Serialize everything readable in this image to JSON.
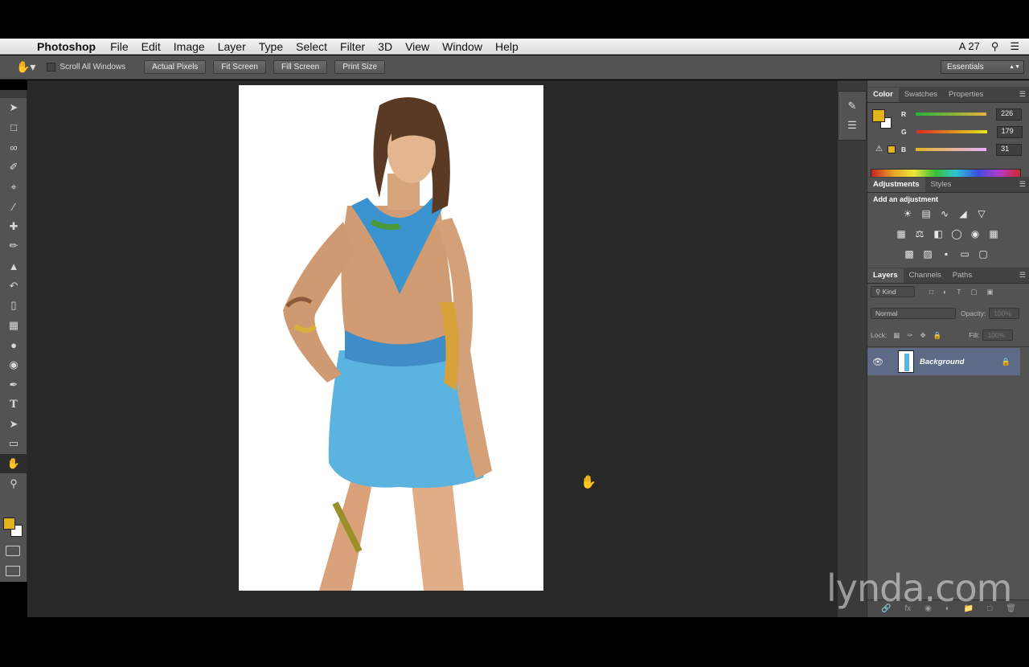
{
  "menubar": {
    "app_name": "Photoshop",
    "items": [
      "File",
      "Edit",
      "Image",
      "Layer",
      "Type",
      "Select",
      "Filter",
      "3D",
      "View",
      "Window",
      "Help"
    ],
    "status_number": "27"
  },
  "options_bar": {
    "scroll_all_windows": "Scroll All Windows",
    "actual_pixels": "Actual Pixels",
    "fit_screen": "Fit Screen",
    "fill_screen": "Fill Screen",
    "print_size": "Print Size",
    "workspace": "Essentials"
  },
  "tools": [
    "move",
    "marquee",
    "lasso",
    "quick-select",
    "crop",
    "eyedropper",
    "healing",
    "brush",
    "clone-stamp",
    "history-brush",
    "eraser",
    "gradient",
    "blur",
    "dodge",
    "pen",
    "type",
    "path-select",
    "rectangle",
    "hand",
    "zoom"
  ],
  "colors": {
    "foreground": "#e2b31f",
    "background": "#ffffff",
    "accent": "#5d6b86"
  },
  "color_panel": {
    "tabs": [
      "Color",
      "Swatches",
      "Properties"
    ],
    "r_label": "R",
    "g_label": "G",
    "b_label": "B",
    "r": "226",
    "g": "179",
    "b": "31"
  },
  "adjustments_panel": {
    "tabs": [
      "Adjustments",
      "Styles"
    ],
    "heading": "Add an adjustment"
  },
  "layers_panel": {
    "tabs": [
      "Layers",
      "Channels",
      "Paths"
    ],
    "filter": "Kind",
    "blend_mode": "Normal",
    "opacity_label": "Opacity:",
    "opacity_value": "100%",
    "lock_label": "Lock:",
    "fill_label": "Fill:",
    "fill_value": "100%",
    "layers": [
      {
        "name": "Background",
        "locked": true,
        "visible": true
      }
    ]
  },
  "watermark": "lynda.com"
}
